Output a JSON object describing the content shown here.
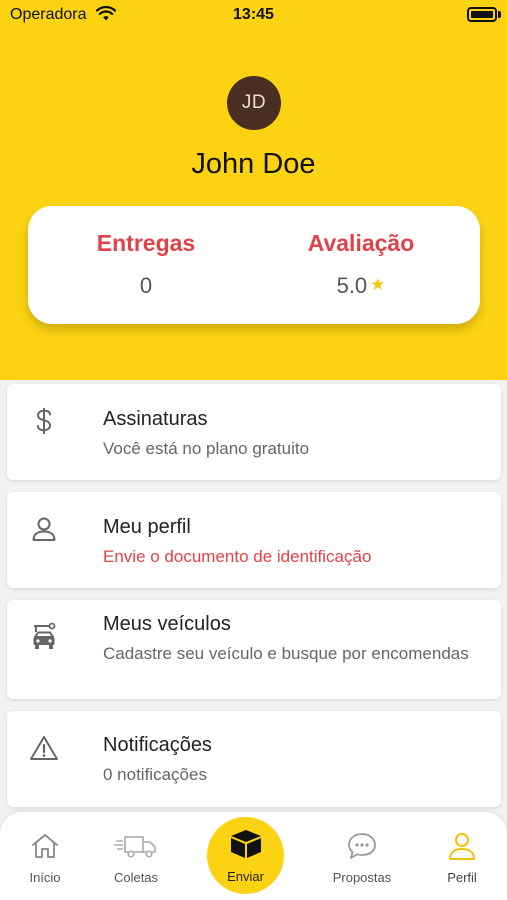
{
  "status_bar": {
    "carrier": "Operadora",
    "time": "13:45"
  },
  "profile": {
    "initials": "JD",
    "name": "John Doe",
    "stats": {
      "deliveries_label": "Entregas",
      "deliveries_value": "0",
      "rating_label": "Avaliação",
      "rating_value": "5.0"
    }
  },
  "menu": [
    {
      "icon": "dollar-icon",
      "title": "Assinaturas",
      "subtitle": "Você está no plano gratuito"
    },
    {
      "icon": "user-icon",
      "title": "Meu perfil",
      "subtitle": "Envie o documento de identificação"
    },
    {
      "icon": "car-icon",
      "title": "Meus veículos",
      "subtitle": "Cadastre seu veículo e busque por encomendas"
    },
    {
      "icon": "warning-icon",
      "title": "Notificações",
      "subtitle": "0 notificações"
    }
  ],
  "tabbar": {
    "items": [
      {
        "icon": "home-icon",
        "label": "Início"
      },
      {
        "icon": "truck-icon",
        "label": "Coletas"
      },
      {
        "icon": "box-icon",
        "label": "Enviar"
      },
      {
        "icon": "chat-icon",
        "label": "Propostas"
      },
      {
        "icon": "user-icon",
        "label": "Perfil"
      }
    ],
    "active": "Perfil"
  },
  "colors": {
    "brand_yellow": "#fcd312",
    "accent_red": "#e0424a",
    "star": "#f6c80a",
    "avatar_bg": "#4a2e22"
  }
}
